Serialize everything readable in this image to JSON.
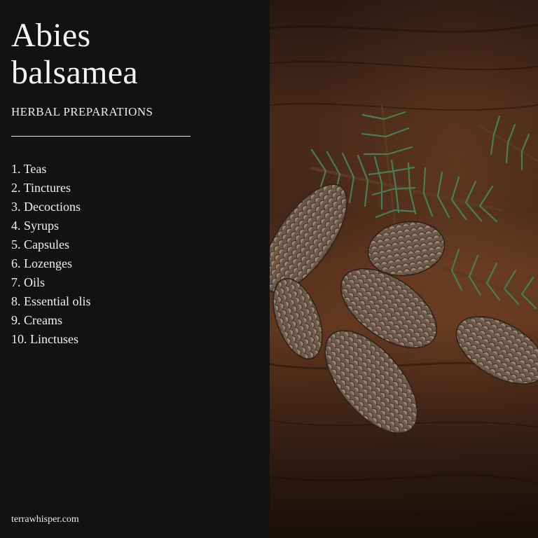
{
  "title_line1": "Abies",
  "title_line2": "balsamea",
  "subtitle": "HERBAL PREPARATIONS",
  "items": [
    "1. Teas",
    "2. Tinctures",
    "3. Decoctions",
    "4. Syrups",
    "5. Capsules",
    "6. Lozenges",
    "7. Oils",
    "8. Essential olis",
    "9. Creams",
    "10. Linctuses"
  ],
  "footer": "terrawhisper.com",
  "colors": {
    "panel_bg": "#121212",
    "text": "#f2f2f2",
    "wood": "#5a3420",
    "needle": "#3f6b4c",
    "cone": "#7a6655"
  }
}
